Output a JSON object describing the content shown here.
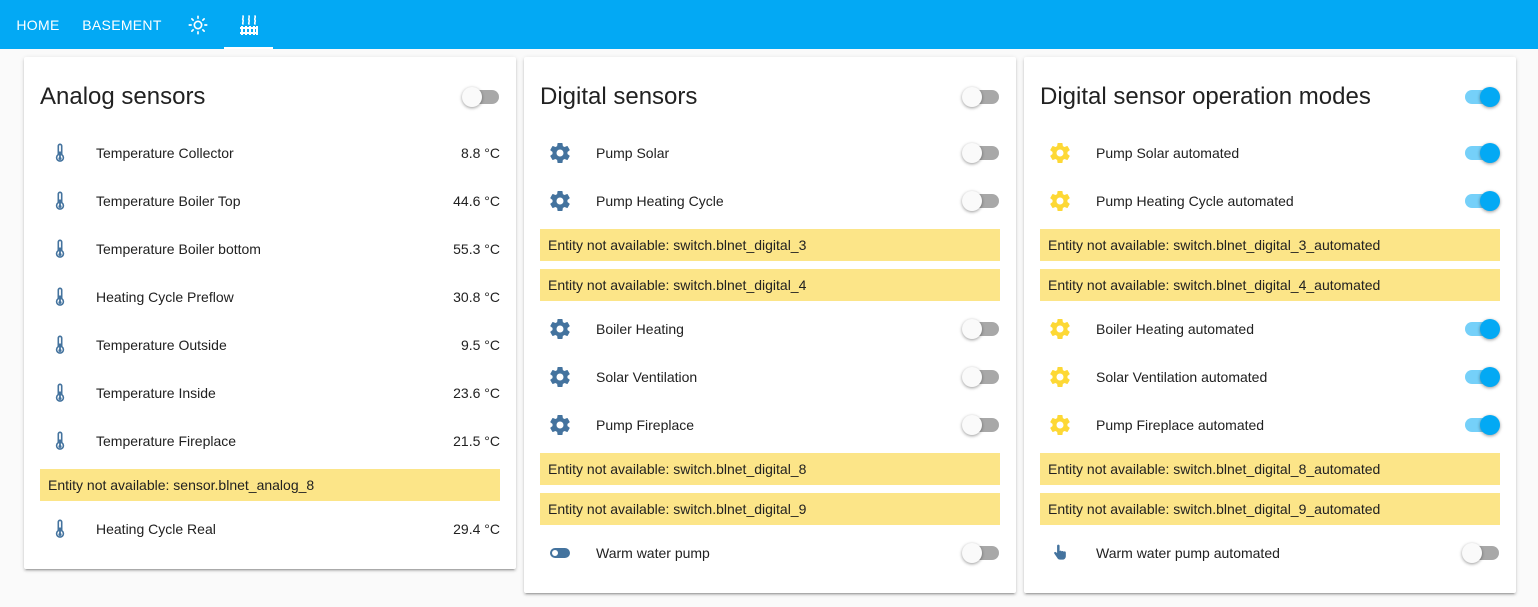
{
  "nav": {
    "tabs": [
      {
        "label": "HOME"
      },
      {
        "label": "BASEMENT"
      },
      {
        "icon": "sun-icon"
      },
      {
        "icon": "heating-icon",
        "active": true
      }
    ]
  },
  "colors": {
    "header": "#03a9f4",
    "warning": "#fce588",
    "thermometer": "#44739e",
    "cog": "#44739e",
    "cog_auto": "#fdd835",
    "toggle_on": "#03a9f4"
  },
  "analog": {
    "title": "Analog sensors",
    "header_toggle_on": false,
    "rows": [
      {
        "label": "Temperature Collector",
        "value": "8.8 °C"
      },
      {
        "label": "Temperature Boiler Top",
        "value": "44.6 °C"
      },
      {
        "label": "Temperature Boiler bottom",
        "value": "55.3 °C"
      },
      {
        "label": "Heating Cycle Preflow",
        "value": "30.8 °C"
      },
      {
        "label": "Temperature Outside",
        "value": "9.5 °C"
      },
      {
        "label": "Temperature Inside",
        "value": "23.6 °C"
      },
      {
        "label": "Temperature Fireplace",
        "value": "21.5 °C"
      },
      {
        "label": "Heating Cycle Real",
        "value": "29.4 °C"
      }
    ],
    "warning": "Entity not available: sensor.blnet_analog_8"
  },
  "digital": {
    "title": "Digital sensors",
    "header_toggle_on": false,
    "rows": [
      {
        "label": "Pump Solar",
        "on": false,
        "icon": "cog-icon"
      },
      {
        "label": "Pump Heating Cycle",
        "on": false,
        "icon": "cog-icon"
      },
      {
        "label": "Boiler Heating",
        "on": false,
        "icon": "cog-icon"
      },
      {
        "label": "Solar Ventilation",
        "on": false,
        "icon": "cog-icon"
      },
      {
        "label": "Pump Fireplace",
        "on": false,
        "icon": "cog-icon"
      },
      {
        "label": "Warm water pump",
        "on": false,
        "icon": "toggle-switch-icon"
      }
    ],
    "warnings": [
      "Entity not available: switch.blnet_digital_3",
      "Entity not available: switch.blnet_digital_4",
      "Entity not available: switch.blnet_digital_8",
      "Entity not available: switch.blnet_digital_9"
    ]
  },
  "modes": {
    "title": "Digital sensor operation modes",
    "header_toggle_on": true,
    "rows": [
      {
        "label": "Pump Solar automated",
        "on": true,
        "icon": "cog-icon"
      },
      {
        "label": "Pump Heating Cycle automated",
        "on": true,
        "icon": "cog-icon"
      },
      {
        "label": "Boiler Heating automated",
        "on": true,
        "icon": "cog-icon"
      },
      {
        "label": "Solar Ventilation automated",
        "on": true,
        "icon": "cog-icon"
      },
      {
        "label": "Pump Fireplace automated",
        "on": true,
        "icon": "cog-icon"
      },
      {
        "label": "Warm water pump automated",
        "on": false,
        "icon": "hand-pointer-icon"
      }
    ],
    "warnings": [
      "Entity not available: switch.blnet_digital_3_automated",
      "Entity not available: switch.blnet_digital_4_automated",
      "Entity not available: switch.blnet_digital_8_automated",
      "Entity not available: switch.blnet_digital_9_automated"
    ]
  }
}
